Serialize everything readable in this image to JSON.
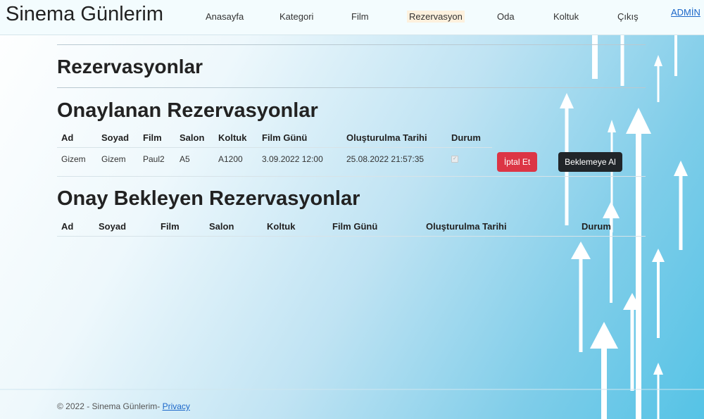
{
  "nav": {
    "brand": "Sinema Günlerim",
    "items": [
      "Anasayfa",
      "Kategori",
      "Film",
      "Rezervasyon",
      "Oda",
      "Koltuk",
      "Çıkış"
    ],
    "user": "ADMİN"
  },
  "page": {
    "title": "Rezervasyonlar",
    "approved_title": "Onaylanan Rezervasyonlar",
    "pending_title": "Onay Bekleyen Rezervasyonlar"
  },
  "headers": [
    "Ad",
    "Soyad",
    "Film",
    "Salon",
    "Koltuk",
    "Film Günü",
    "Oluşturulma Tarihi",
    "Durum"
  ],
  "approved_rows": [
    {
      "ad": "Gizem",
      "soyad": "Gizem",
      "film": "Paul2",
      "salon": "A5",
      "koltuk": "A1200",
      "film_gunu": "3.09.2022 12:00",
      "olusturma": "25.08.2022 21:57:35",
      "durum": true,
      "cancel_label": "İptal Et",
      "hold_label": "Beklemeye Al"
    }
  ],
  "footer": {
    "text": "© 2022 - Sinema Günlerim-",
    "privacy": "Privacy"
  }
}
